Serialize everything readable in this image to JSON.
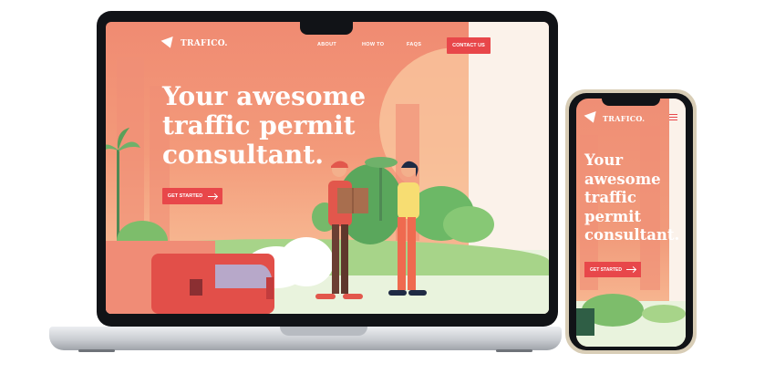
{
  "brand": {
    "name": "TRAFICO."
  },
  "nav": {
    "links": [
      "ABOUT",
      "HOW TO",
      "FAQS"
    ],
    "contact_label": "CONTACT US"
  },
  "hero": {
    "title_lines": [
      "Your awesome",
      "traffic permit",
      "consultant."
    ],
    "cta_label": "GET STARTED"
  },
  "mobile": {
    "title_lines": [
      "Your",
      "awesome",
      "traffic",
      "permit",
      "consultant."
    ],
    "cta_label": "GET STARTED"
  },
  "colors": {
    "accent": "#e8474a",
    "hero_bg": "#f08b72",
    "cream": "#fbf2ea",
    "green": "#a7d489"
  },
  "icons": [
    "brand-logo-icon",
    "arrow-right-icon",
    "hamburger-menu-icon"
  ]
}
